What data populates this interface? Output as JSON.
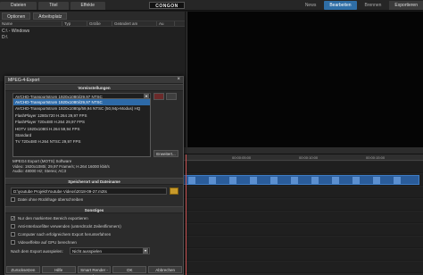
{
  "topbar": {
    "left_tabs": [
      "Dateien",
      "Titel",
      "Effekte"
    ],
    "logo": "CONGON",
    "right_nav": [
      {
        "label": "News",
        "state": "normal"
      },
      {
        "label": "Bearbeiten",
        "state": "active"
      },
      {
        "label": "Brennen",
        "state": "normal"
      },
      {
        "label": "Exportieren",
        "state": "dark"
      }
    ]
  },
  "media_panel": {
    "toolbar": [
      "Optionen",
      "Arbeitsplatz"
    ],
    "columns": [
      "Name",
      "Typ",
      "Größe",
      "Geändert am",
      "Au"
    ],
    "tree": [
      "C:\\ - Windows",
      "D:\\"
    ]
  },
  "dialog": {
    "title": "MPEG-4-Export",
    "close": "×",
    "section_presets": "Voreinstellungen",
    "preset_selected": "AVCHD-Transportstrom 1920x1080i/29,97 NTSC",
    "presets": [
      "AVCHD-Transportstrom 1920x1080i/29,97 NTSC",
      "AVCHD-Transportstrom 1920x1080p/59,94 NTSC (50,94p-Modus) HQ",
      "FlashPlayer 1280x720 H.264 29,97 FPS",
      "FlashPlayer 720x480 H.264 29,97 FPS",
      "HDTV 1920x1080i H.264 59,94 FPS",
      "Standard",
      "TV 720x480 H.264 NTSC 29,97 FPS"
    ],
    "selected_index": 0,
    "advanced_button": "Erweitert...",
    "info_lines": [
      "MPEG4 Export (MOTS) Software",
      "Video: 1920x1080i; 29,97 Frame/s; H.264 16000 kbit/s",
      "Audio: 48000 Hz; Stereo; AC3"
    ],
    "section_save": "Speicherort und Dateiname",
    "path": "D:\\youtube Projekt\\Youtube Videos\\2018-09-27.m2ts",
    "overwrite_label": "Datei ohne Rückfrage überschreiben",
    "section_other": "Sonstiges",
    "options": [
      {
        "label": "Nur den markierten Bereich exportieren",
        "checked": true
      },
      {
        "label": "Anti-Interlacefilter verwenden (unterdrückt Zeilenflimmern)",
        "checked": false
      },
      {
        "label": "Computer nach erfolgreichem Export herunterfahren",
        "checked": false
      },
      {
        "label": "Videoeffekte auf GPU berechnen",
        "checked": false
      }
    ],
    "after_export_label": "Nach dem Export ausspielen:",
    "after_export_value": "Nicht ausspielen",
    "footer_buttons": [
      "Zurücksetzen",
      "Hilfe",
      "Smart Render - Info...",
      "OK",
      "Abbrechen"
    ]
  },
  "timeline": {
    "ruler": [
      "00:00:05:00",
      "00:00:10:00",
      "00:00:15:00"
    ]
  }
}
